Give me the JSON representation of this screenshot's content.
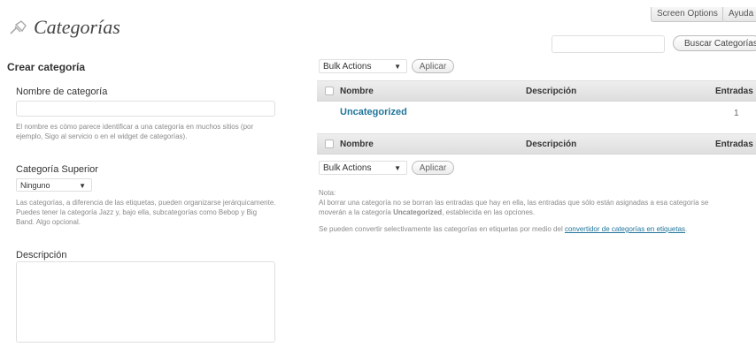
{
  "header": {
    "title": "Categorías",
    "top_buttons": [
      "Screen Options",
      "Ayuda"
    ],
    "search_button": "Buscar Categorías"
  },
  "left": {
    "section_title": "Crear categoría",
    "name_label": "Nombre de categoría",
    "name_help": "El nombre es cómo parece identificar a una categoría en muchos sitios (por ejemplo, Sigo al servicio o en el widget de categorías).",
    "parent_label": "Categoría Superior",
    "parent_value": "Ninguno",
    "parent_help": "Las categorías, a diferencia de las etiquetas, pueden organizarse jerárquicamente. Puedes tener la categoría Jazz y, bajo ella, subcategorías como Bebop y Big Band. Algo opcional.",
    "description_label": "Descripción"
  },
  "right": {
    "bulk_actions": "Bulk Actions",
    "apply": "Aplicar",
    "columns": [
      "Nombre",
      "Descripción",
      "Entradas"
    ],
    "rows": [
      {
        "name": "Uncategorized",
        "description": "",
        "count": "1"
      }
    ],
    "note_title": "Nota:",
    "note_text_1": "Al borrar una categoría no se borran las entradas que hay en ella, las entradas que sólo están asignadas a esa categoría se moverán a la categoría",
    "note_bold": "Uncategorized",
    "note_text_2": ", establecida en las opciones.",
    "note_text_3": "Se pueden convertir selectivamente las categorías en etiquetas por medio del",
    "note_link": "convertidor de categorías en etiquetas",
    "note_end": "."
  }
}
